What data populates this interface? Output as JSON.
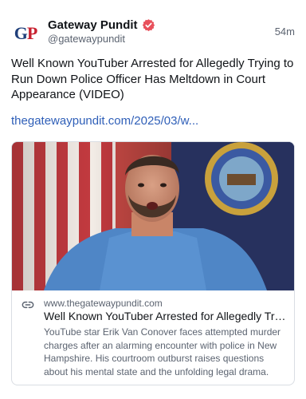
{
  "author": {
    "avatar_text_g": "G",
    "avatar_text_p": "P",
    "display_name": "Gateway Pundit",
    "handle": "@gatewaypundit",
    "verified_icon": "verified-badge-icon",
    "verified_color": "#e8515c"
  },
  "post": {
    "timestamp": "54m",
    "text": "Well Known YouTuber Arrested for Allegedly Trying to Run Down Police Officer Has Meltdown in Court Appearance (VIDEO)",
    "link_text": "thegatewaypundit.com/2025/03/w..."
  },
  "link_card": {
    "icon": "link-icon",
    "domain": "www.thegatewaypundit.com",
    "title": "Well Known YouTuber Arrested for Allegedly Trying to Run Down Police Officer Has Meltdown in Court Appearance (VIDEO)",
    "description": "YouTube star Erik Van Conover faces attempted murder charges after an alarming encounter with police in New Hampshire. His courtroom outburst raises questions about his mental state and the unfolding legal drama."
  },
  "colors": {
    "link": "#2f5fb8",
    "text": "#111418",
    "secondary_text": "#5b6370",
    "card_border": "#d9dde3"
  }
}
